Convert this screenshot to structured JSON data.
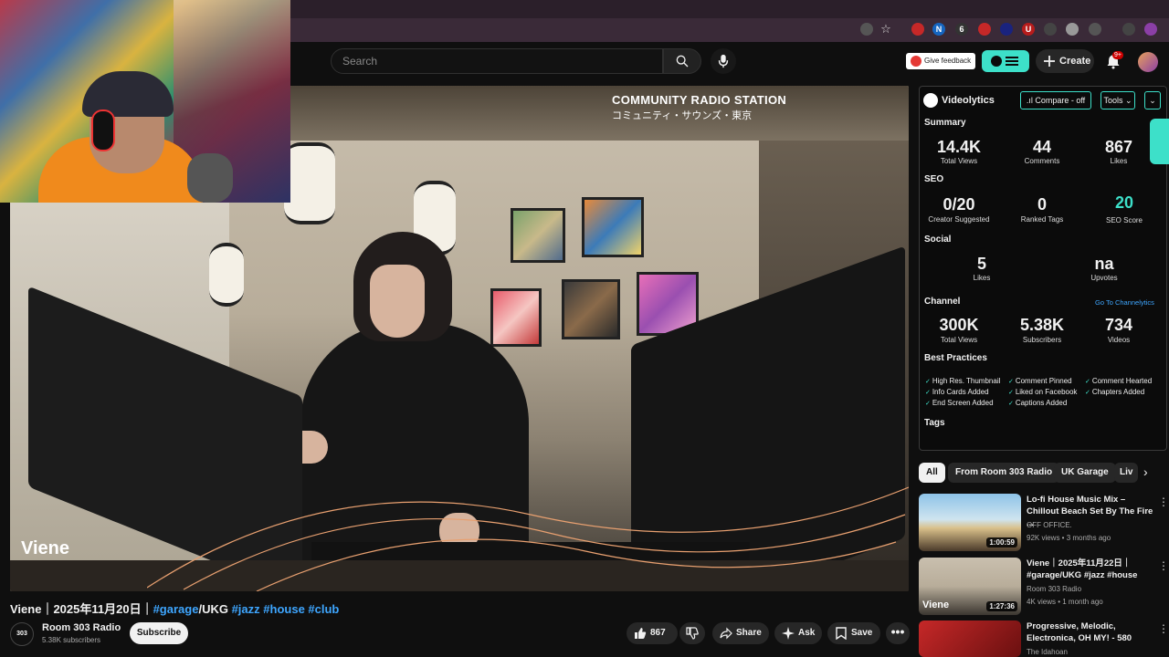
{
  "header": {
    "search_placeholder": "Search",
    "feedback_label": "Give feedback",
    "create_label": "Create",
    "notification_count": "9+"
  },
  "player": {
    "station_title": "COMMUNITY RADIO STATION",
    "station_subtitle": "コミュニティ・サウンズ・東京",
    "artist_overlay": "Viene"
  },
  "video": {
    "title_prefix": "Viene｜2025年11月20日｜",
    "tag1": "#garage",
    "title_mid": "/UKG ",
    "tag2": "#jazz",
    "tag3": "#house",
    "tag4": "#club",
    "channel_avatar_text": "303",
    "channel_name": "Room 303 Radio",
    "channel_subs": "5.38K subscribers",
    "subscribe_label": "Subscribe",
    "likes": "867",
    "share_label": "Share",
    "ask_label": "Ask",
    "save_label": "Save"
  },
  "videolytics": {
    "name": "Videolytics",
    "compare_label": ".ıl Compare - off",
    "tools_label": "Tools ⌄",
    "summary_title": "Summary",
    "summary": [
      {
        "value": "14.4K",
        "label": "Total Views"
      },
      {
        "value": "44",
        "label": "Comments"
      },
      {
        "value": "867",
        "label": "Likes"
      }
    ],
    "seo_title": "SEO",
    "seo": [
      {
        "value": "0/20",
        "label": "Creator Suggested"
      },
      {
        "value": "0",
        "label": "Ranked Tags"
      },
      {
        "value": "20",
        "label": "SEO Score"
      }
    ],
    "social_title": "Social",
    "social": [
      {
        "value": "5",
        "label": "Likes"
      },
      {
        "value": "na",
        "label": "Upvotes"
      }
    ],
    "channel_title": "Channel",
    "channel_link": "Go To Channelytics",
    "channel": [
      {
        "value": "300K",
        "label": "Total Views"
      },
      {
        "value": "5.38K",
        "label": "Subscribers"
      },
      {
        "value": "734",
        "label": "Videos"
      }
    ],
    "best_practices_title": "Best Practices",
    "best_practices": [
      "High Res. Thumbnail",
      "Comment Pinned",
      "Comment Hearted",
      "Info Cards Added",
      "Liked on Facebook",
      "Chapters Added",
      "End Screen Added",
      "Captions Added"
    ],
    "tags_title": "Tags",
    "accent_color": "#3de0c9"
  },
  "chips": [
    "All",
    "From Room 303 Radio",
    "UK Garage",
    "Liv"
  ],
  "recommended": [
    {
      "title": "Lo-fi House Music Mix – Chillout Beach Set By The Fire ...",
      "channel": "OFF OFFICE.",
      "meta": "92K views • 3 months ago",
      "duration": "1:00:59"
    },
    {
      "title": "Viene｜2025年11月22日｜#garage/UKG #jazz #house",
      "channel": "Room 303 Radio",
      "meta": "4K views • 1 month ago",
      "duration": "1:27:36",
      "thumb_text": "Viene"
    },
    {
      "title": "Progressive, Melodic, Electronica, OH MY! - 580",
      "channel": "The Idahoan",
      "meta": "",
      "duration": ""
    }
  ]
}
